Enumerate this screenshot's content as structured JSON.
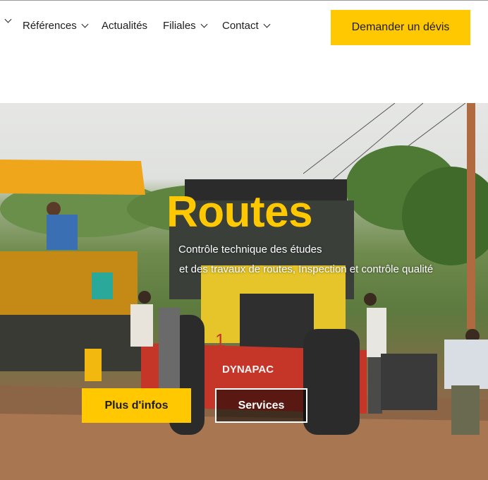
{
  "nav": {
    "items": [
      {
        "label": "",
        "has_dropdown": true
      },
      {
        "label": "Références",
        "has_dropdown": true
      },
      {
        "label": "Actualités",
        "has_dropdown": false
      },
      {
        "label": "Filiales",
        "has_dropdown": true
      },
      {
        "label": "Contact",
        "has_dropdown": true
      }
    ],
    "cta_label": "Demander un dévis"
  },
  "hero": {
    "title": "Routes",
    "subtitle_line1": "Contrôle technique des études",
    "subtitle_line2": "et des travaux de routes, Inspection et contrôle qualité",
    "primary_button": "Plus d'infos",
    "secondary_button": "Services",
    "roller_brand": "DYNAPAC",
    "roller_number": "1"
  },
  "colors": {
    "accent": "#ffc800",
    "text": "#1d1d1d",
    "white": "#ffffff"
  }
}
